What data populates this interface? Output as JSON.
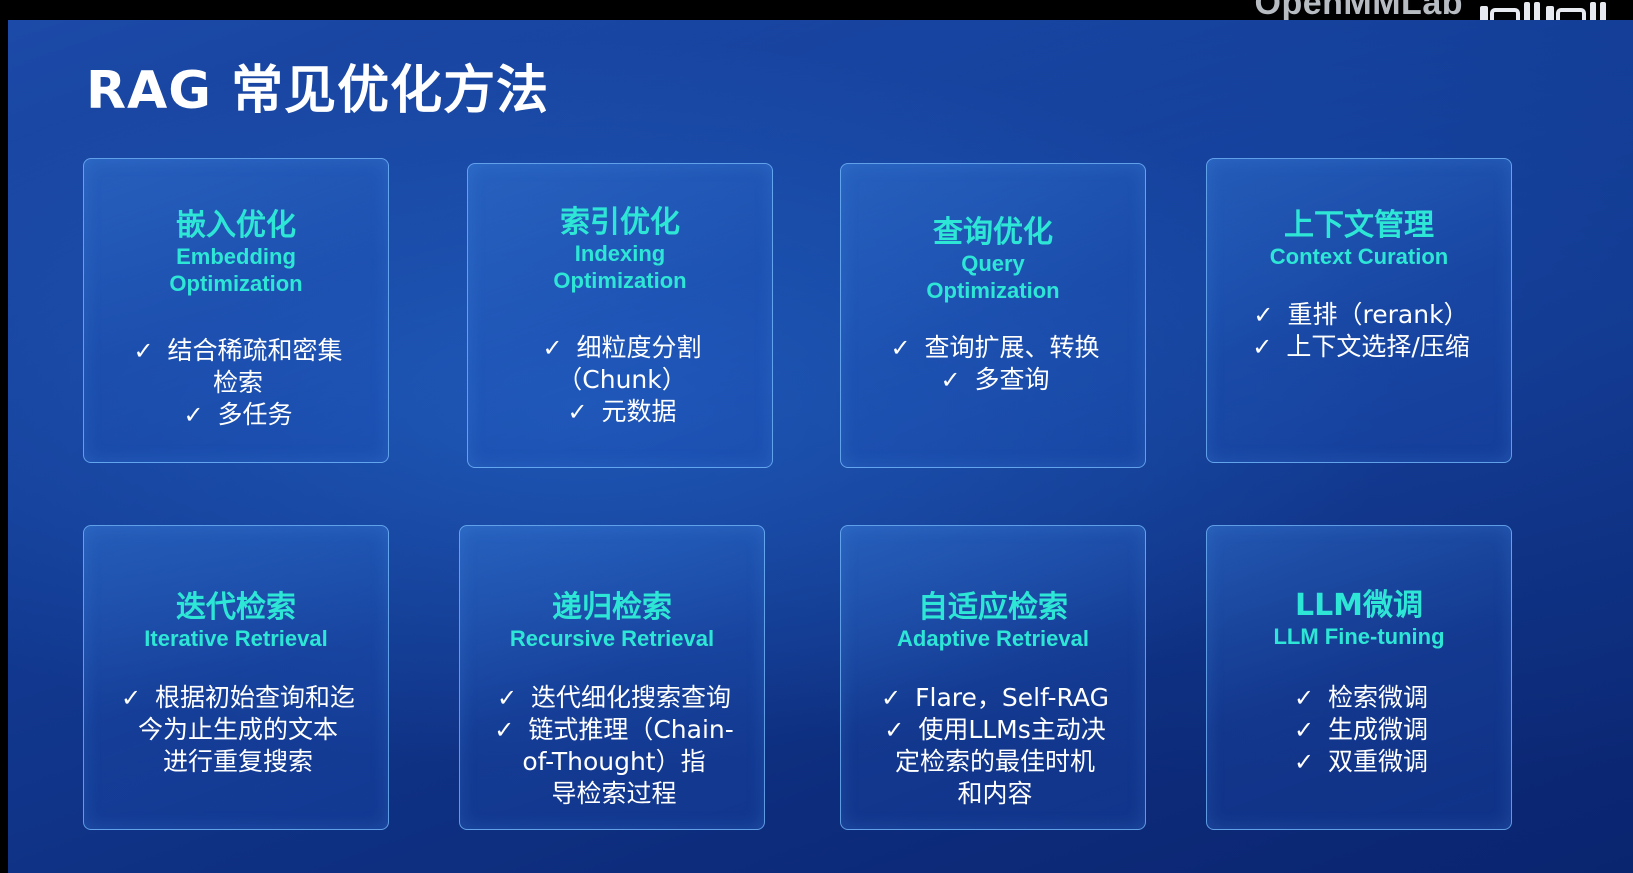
{
  "watermark": {
    "text": "OpenMMLab"
  },
  "title": "RAG 常见优化方法",
  "cards": [
    {
      "cn": "嵌入优化",
      "en": "Embedding\nOptimization",
      "items": [
        "结合稀疏和密集\n检索",
        "多任务"
      ]
    },
    {
      "cn": "索引优化",
      "en": "Indexing\nOptimization",
      "items": [
        "细粒度分割\n（Chunk）",
        "元数据"
      ]
    },
    {
      "cn": "查询优化",
      "en": "Query\nOptimization",
      "items": [
        "查询扩展、转换",
        "多查询"
      ]
    },
    {
      "cn": "上下文管理",
      "en": "Context Curation",
      "items": [
        "重排（rerank）",
        "上下文选择/压缩"
      ]
    },
    {
      "cn": "迭代检索",
      "en": "Iterative Retrieval",
      "items": [
        "根据初始查询和迄\n今为止生成的文本\n进行重复搜索"
      ]
    },
    {
      "cn": "递归检索",
      "en": "Recursive Retrieval",
      "items": [
        "迭代细化搜索查询",
        "链式推理（Chain-\nof-Thought）指\n导检索过程"
      ]
    },
    {
      "cn": "自适应检索",
      "en": "Adaptive Retrieval",
      "items": [
        "Flare，Self-RAG",
        "使用LLMs主动决\n定检索的最佳时机\n和内容"
      ]
    },
    {
      "cn": "LLM微调",
      "en": "LLM Fine-tuning",
      "items": [
        "检索微调",
        "生成微调",
        "双重微调"
      ]
    }
  ],
  "check_symbol": "✓",
  "colors": {
    "accent": "#2ee6d6",
    "background": "#123a92",
    "border": "#78beff"
  }
}
